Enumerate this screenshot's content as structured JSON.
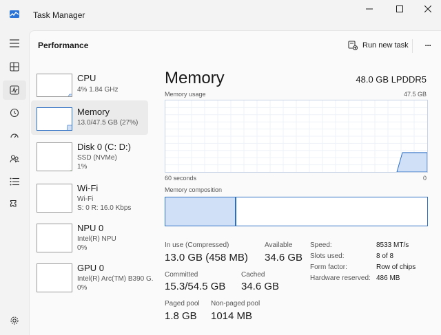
{
  "window": {
    "title": "Task Manager"
  },
  "header": {
    "title": "Performance",
    "run_new_task": "Run new task",
    "more": "···"
  },
  "colors": {
    "accent": "#1a5fb4",
    "graph_fill": "#cfe0f7",
    "graph_line": "#2c6ec4"
  },
  "nav": [
    "hamburger-icon",
    "processes-icon",
    "performance-icon",
    "app-history-icon",
    "startup-apps-icon",
    "users-icon",
    "details-icon",
    "services-icon",
    "settings-icon"
  ],
  "list": [
    {
      "name": "CPU",
      "sub1": "4%  1.84 GHz",
      "sub2": "",
      "sub3": "",
      "level": 0.04
    },
    {
      "name": "Memory",
      "sub1": "13.0/47.5 GB (27%)",
      "sub2": "",
      "sub3": "",
      "level": 0.27
    },
    {
      "name": "Disk 0 (C: D:)",
      "sub1": "SSD (NVMe)",
      "sub2": "1%",
      "sub3": "",
      "level": 0.01
    },
    {
      "name": "Wi-Fi",
      "sub1": "Wi-Fi",
      "sub2": "S: 0  R: 16.0 Kbps",
      "sub3": "",
      "level": 0.0
    },
    {
      "name": "NPU 0",
      "sub1": "Intel(R) NPU",
      "sub2": "0%",
      "sub3": "",
      "level": 0.0
    },
    {
      "name": "GPU 0",
      "sub1": "Intel(R) Arc(TM) B390 G.",
      "sub2": "0%",
      "sub3": "",
      "level": 0.0
    }
  ],
  "memory": {
    "title": "Memory",
    "spec": "48.0 GB LPDDR5",
    "usage_label": "Memory usage",
    "usage_max": "47.5 GB",
    "axis_left": "60 seconds",
    "axis_right": "0",
    "composition_label": "Memory composition",
    "composition_in_use_fraction": 0.27
  },
  "stats": {
    "in_use_label": "In use (Compressed)",
    "in_use_value": "13.0 GB (458 MB)",
    "available_label": "Available",
    "available_value": "34.6 GB",
    "committed_label": "Committed",
    "committed_value": "15.3/54.5 GB",
    "cached_label": "Cached",
    "cached_value": "34.6 GB",
    "paged_label": "Paged pool",
    "paged_value": "1.8 GB",
    "nonpaged_label": "Non-paged pool",
    "nonpaged_value": "1014 MB"
  },
  "details": [
    {
      "label": "Speed:",
      "value": "8533 MT/s"
    },
    {
      "label": "Slots used:",
      "value": "8 of 8"
    },
    {
      "label": "Form factor:",
      "value": "Row of chips"
    },
    {
      "label": "Hardware reserved:",
      "value": "486 MB"
    }
  ]
}
